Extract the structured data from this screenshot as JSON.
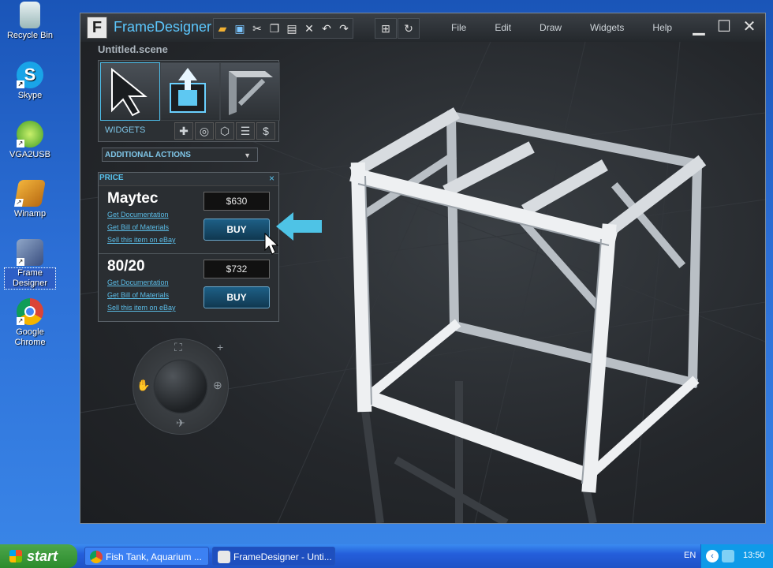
{
  "desktop": {
    "icons": [
      {
        "label": "Recycle Bin",
        "icon": "recycle-bin-icon"
      },
      {
        "label": "Skype",
        "icon": "skype-icon"
      },
      {
        "label": "VGA2USB",
        "icon": "vga2usb-icon"
      },
      {
        "label": "Winamp",
        "icon": "winamp-icon"
      },
      {
        "label": "Frame Designer",
        "icon": "frame-designer-icon"
      },
      {
        "label": "Google Chrome",
        "icon": "chrome-icon"
      }
    ]
  },
  "window": {
    "app_title": "FrameDesigner",
    "app_logo": "F",
    "scene_name": "Untitled.scene",
    "menu": [
      "File",
      "Edit",
      "Draw",
      "Widgets",
      "Help"
    ],
    "toolbar_icons": [
      "open-folder-icon",
      "save-icon",
      "cut-icon",
      "copy-icon",
      "paste-icon",
      "delete-icon",
      "undo-icon",
      "redo-icon"
    ]
  },
  "palette": {
    "label": "WIDGETS",
    "tools": [
      "select-arrow-tool",
      "extrude-tool",
      "frame-profile-tool"
    ],
    "widget_buttons": [
      "add-icon",
      "target-icon",
      "cube-icon",
      "list-icon",
      "dollar-icon"
    ]
  },
  "additional_actions": {
    "label": "ADDITIONAL ACTIONS"
  },
  "price_panel": {
    "title": "PRICE",
    "close": "×",
    "vendors": [
      {
        "name": "Maytec",
        "price": "$630",
        "buy": "BUY",
        "links": [
          "Get Documentation",
          "Get Bill of Materials",
          "Sell this item on eBay"
        ]
      },
      {
        "name": "80/20",
        "price": "$732",
        "buy": "BUY",
        "links": [
          "Get Documentation",
          "Get Bill of Materials",
          "Sell this item on eBay"
        ]
      }
    ]
  },
  "taskbar": {
    "start": "start",
    "tasks": [
      {
        "label": "Fish Tank, Aquarium ...",
        "icon": "chrome-icon"
      },
      {
        "label": "FrameDesigner - Unti...",
        "icon": "frame-designer-icon"
      }
    ],
    "language": "EN",
    "clock": "13:50"
  },
  "colors": {
    "accent": "#5cc8ff",
    "buy_button": "#1d5f86",
    "arrow": "#4ec3e6"
  }
}
